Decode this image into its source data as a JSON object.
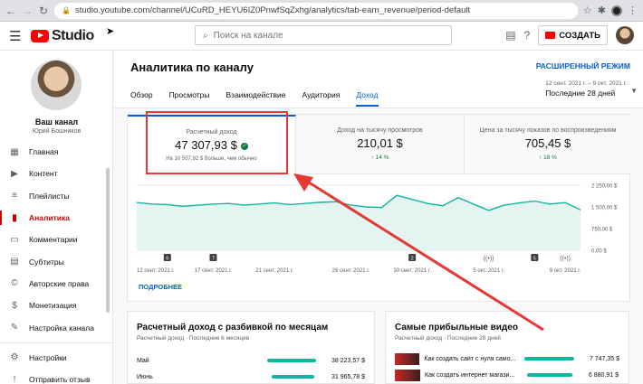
{
  "browser": {
    "url": "studio.youtube.com/channel/UCuRD_HEYU6IZ0PnwfSqZxhg/analytics/tab-earn_revenue/period-default"
  },
  "header": {
    "logo": "Studio",
    "search_placeholder": "Поиск на канале",
    "create_label": "СОЗДАТЬ"
  },
  "sidebar": {
    "channel_name": "Ваш канал",
    "channel_owner": "Юрий Бошников",
    "items": [
      {
        "label": "Главная",
        "icon": "dashboard-icon"
      },
      {
        "label": "Контент",
        "icon": "content-icon"
      },
      {
        "label": "Плейлисты",
        "icon": "playlist-icon"
      },
      {
        "label": "Аналитика",
        "icon": "analytics-icon",
        "active": true
      },
      {
        "label": "Комментарии",
        "icon": "comments-icon"
      },
      {
        "label": "Субтитры",
        "icon": "subtitles-icon"
      },
      {
        "label": "Авторские права",
        "icon": "copyright-icon"
      },
      {
        "label": "Монетизация",
        "icon": "monetization-icon"
      },
      {
        "label": "Настройка канала",
        "icon": "customization-icon"
      }
    ],
    "bottom_items": [
      {
        "label": "Настройки",
        "icon": "gear-icon"
      },
      {
        "label": "Отправить отзыв",
        "icon": "feedback-icon"
      }
    ]
  },
  "main": {
    "title": "Аналитика по каналу",
    "advanced_mode": "РАСШИРЕННЫЙ РЕЖИМ",
    "tabs": [
      "Обзор",
      "Просмотры",
      "Взаимодействие",
      "Аудитория",
      "Доход"
    ],
    "active_tab": "Доход",
    "period": {
      "range": "12 сент. 2021 г. – 9 окт. 2021 г.",
      "label": "Последние 28 дней"
    },
    "metrics": [
      {
        "label": "Расчетный доход",
        "value": "47 307,93 $",
        "note": "На 10 507,92 $ больше, чем обычно"
      },
      {
        "label": "Доход на тысячу просмотров",
        "value": "210,01 $",
        "change": "↑ 14 %"
      },
      {
        "label": "Цена за тысячу показов по воспроизведениям",
        "value": "705,45 $",
        "change": "↑ 18 %"
      }
    ],
    "more_link": "ПОДРОБНЕЕ",
    "monthly": {
      "title": "Расчетный доход с разбивкой по месяцам",
      "subtitle": "Расчетный доход · Последние 6 месяцев",
      "rows": [
        {
          "month": "Май",
          "value": "38 223,57 $"
        },
        {
          "month": "Июнь",
          "value": "31 965,78 $"
        }
      ]
    },
    "top_videos": {
      "title": "Самые прибыльные видео",
      "subtitle": "Расчетный доход · Последние 28 дней",
      "rows": [
        {
          "title": "Как создать сайт с нуля само...",
          "value": "7 747,35 $"
        },
        {
          "title": "Как создать интернет магази...",
          "value": "6 880,91 $"
        }
      ]
    }
  },
  "chart_data": {
    "type": "area",
    "y_ticks": [
      "2 250,00 $",
      "1 500,00 $",
      "750,00 $",
      "0,00 $"
    ],
    "ylim": [
      0,
      2250
    ],
    "x_labels": [
      "12 сент. 2021 г.",
      "17 сент. 2021 г.",
      "21 сент. 2021 г.",
      "26 сент. 2021 г.",
      "30 сент. 2021 г.",
      "5 окт. 2021 г.",
      "9 окт. 2021 г."
    ],
    "values": [
      1650,
      1600,
      1580,
      1520,
      1560,
      1600,
      1620,
      1560,
      1600,
      1640,
      1580,
      1620,
      1660,
      1680,
      1560,
      1500,
      1480,
      1900,
      1760,
      1620,
      1540,
      1820,
      1600,
      1380,
      1560,
      1640,
      1700,
      1600,
      1650,
      1400
    ],
    "markers": [
      "6",
      "7",
      "2",
      "5"
    ]
  },
  "colors": {
    "accent": "#065fd4",
    "line": "#12b5a0",
    "highlight": "#e53935",
    "brand": "#ff0000"
  }
}
